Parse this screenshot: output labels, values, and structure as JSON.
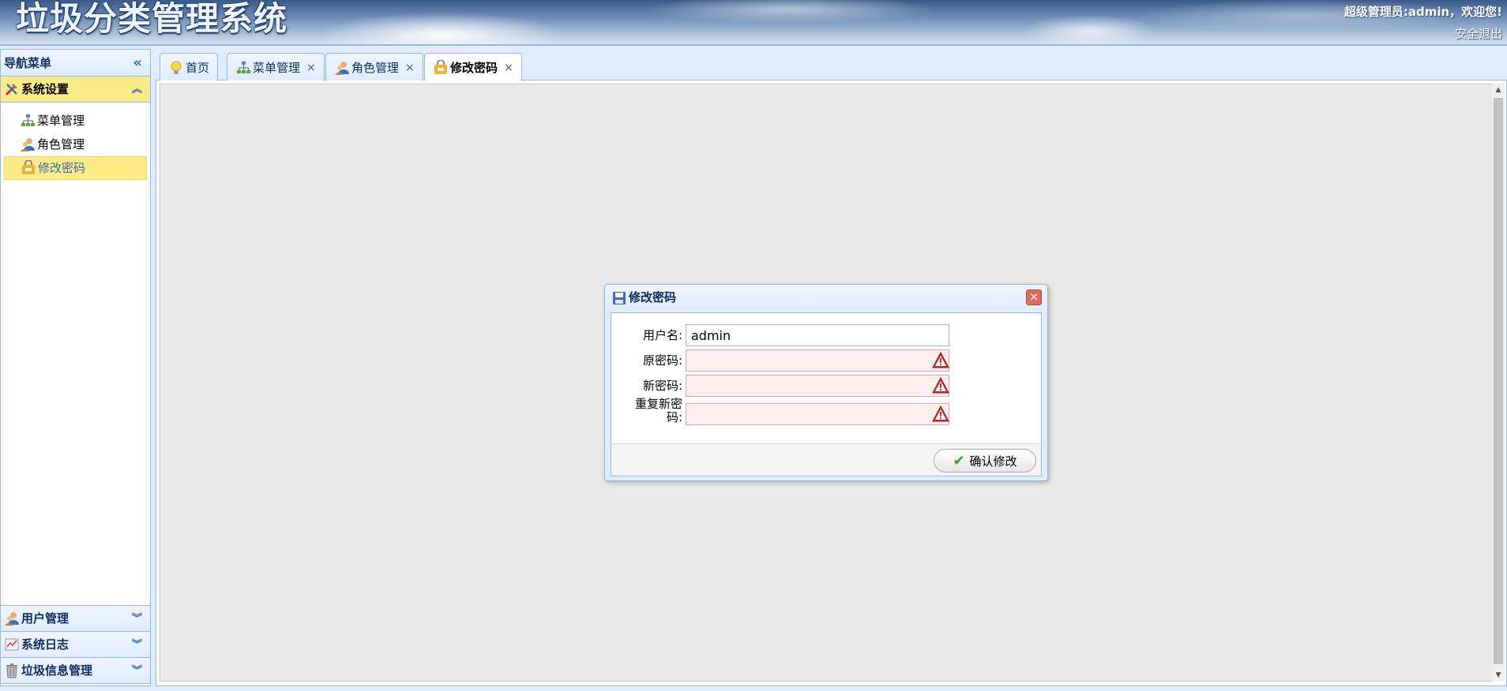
{
  "header": {
    "app_title": "垃圾分类管理系统",
    "welcome": "超级管理员:admin，欢迎您!",
    "logout": "安全退出"
  },
  "nav": {
    "title": "导航菜单",
    "collapse_icon": "«",
    "sections": [
      {
        "label": "系统设置",
        "icon": "tools-icon",
        "expanded": true
      },
      {
        "label": "用户管理",
        "icon": "users-icon",
        "expanded": false
      },
      {
        "label": "系统日志",
        "icon": "log-icon",
        "expanded": false
      },
      {
        "label": "垃圾信息管理",
        "icon": "trash-icon",
        "expanded": false
      }
    ],
    "items": [
      {
        "label": "菜单管理",
        "icon": "sitemap-icon"
      },
      {
        "label": "角色管理",
        "icon": "role-icon"
      },
      {
        "label": "修改密码",
        "icon": "password-icon",
        "selected": true
      }
    ]
  },
  "tabs": [
    {
      "label": "首页",
      "icon": "bulb-icon",
      "closable": false
    },
    {
      "label": "菜单管理",
      "icon": "sitemap-icon",
      "closable": true
    },
    {
      "label": "角色管理",
      "icon": "role-icon",
      "closable": true
    },
    {
      "label": "修改密码",
      "icon": "password-icon",
      "closable": true,
      "active": true
    }
  ],
  "tab_close_glyph": "×",
  "dialog": {
    "title": "修改密码",
    "close_glyph": "×",
    "fields": [
      {
        "label": "用户名:",
        "value": "admin",
        "invalid": false
      },
      {
        "label": "原密码:",
        "value": "",
        "invalid": true
      },
      {
        "label": "新密码:",
        "value": "",
        "invalid": true
      },
      {
        "label": "重复新密码:",
        "value": "",
        "invalid": true
      }
    ],
    "confirm_label": "确认修改"
  },
  "colors": {
    "panel_border": "#95b8e7",
    "panel_header": "#e0ecff",
    "selected_bg": "#fbec88",
    "invalid_bg": "#ffeeee"
  }
}
